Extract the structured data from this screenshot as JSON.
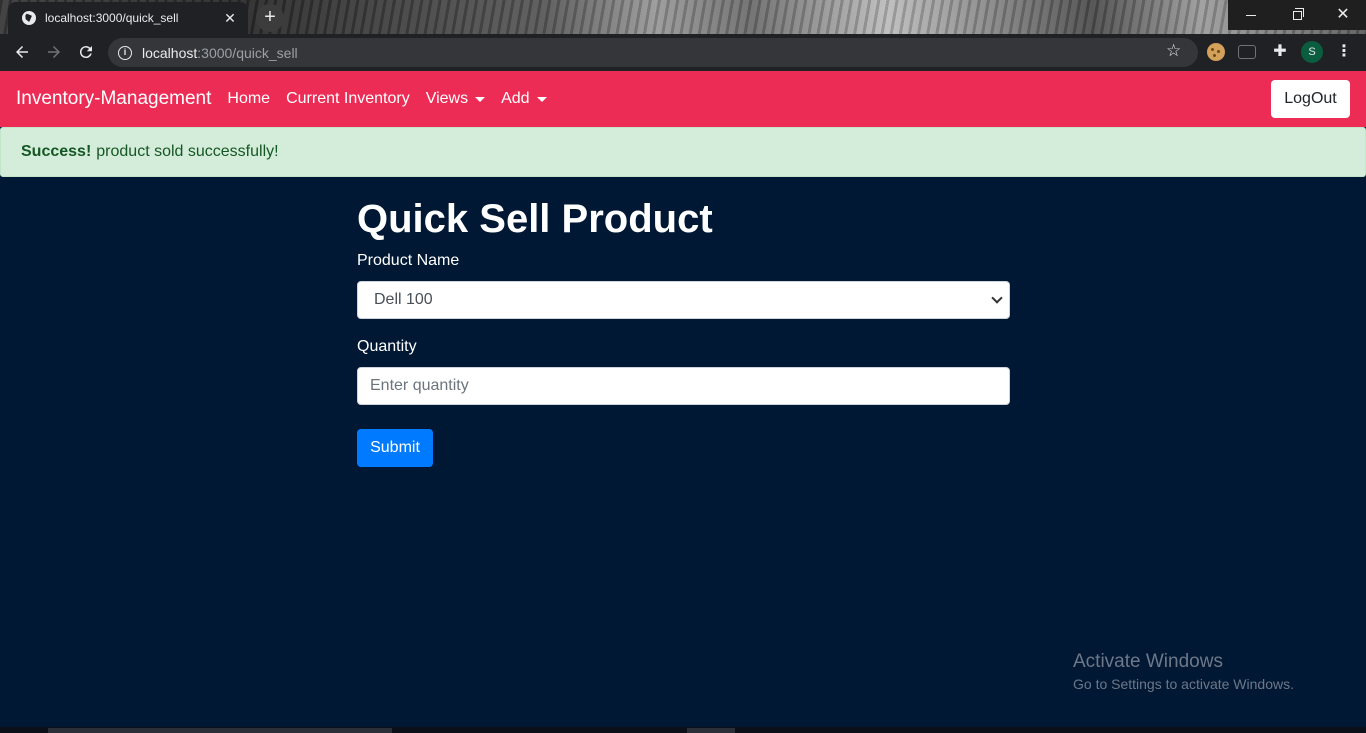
{
  "browser": {
    "tab_title": "localhost:3000/quick_sell",
    "tab_close": "✕",
    "new_tab": "+",
    "url_host": "localhost",
    "url_path": ":3000/quick_sell",
    "profile_initial": "S"
  },
  "navbar": {
    "brand": "Inventory-Management",
    "links": [
      {
        "label": "Home"
      },
      {
        "label": "Current Inventory"
      },
      {
        "label": "Views"
      },
      {
        "label": "Add"
      }
    ],
    "logout_label": "LogOut"
  },
  "alert": {
    "strong": "Success!",
    "message": "product sold successfully!"
  },
  "form": {
    "title": "Quick Sell Product",
    "product_label": "Product Name",
    "product_selected": "Dell 100",
    "quantity_label": "Quantity",
    "quantity_placeholder": "Enter quantity",
    "submit_label": "Submit"
  },
  "watermark": {
    "title": "Activate Windows",
    "subtitle": "Go to Settings to activate Windows."
  },
  "colors": {
    "navbar": "#ec2c55",
    "page_bg": "#001833",
    "alert_bg": "#d4edda",
    "primary": "#007bff"
  }
}
